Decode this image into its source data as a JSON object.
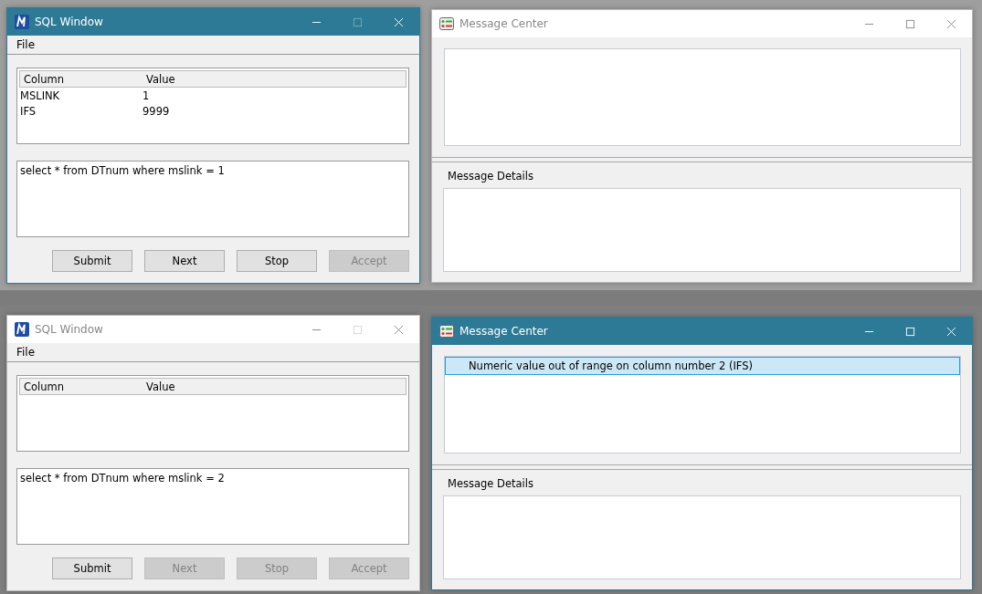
{
  "screens": [
    {
      "sql_window": {
        "title": "SQL Window",
        "active": true,
        "menu": [
          "File"
        ],
        "columns": [
          "Column",
          "Value"
        ],
        "rows": [
          [
            "MSLINK",
            "1"
          ],
          [
            "IFS",
            "9999"
          ]
        ],
        "query": "select * from DTnum where mslink = 1",
        "buttons": [
          {
            "label": "Submit",
            "disabled": false
          },
          {
            "label": "Next",
            "disabled": false
          },
          {
            "label": "Stop",
            "disabled": false
          },
          {
            "label": "Accept",
            "disabled": true
          }
        ]
      },
      "message_center": {
        "title": "Message Center",
        "active": false,
        "details_label": "Message Details"
      }
    },
    {
      "sql_window": {
        "title": "SQL Window",
        "active": false,
        "menu": [
          "File"
        ],
        "columns": [
          "Column",
          "Value"
        ],
        "query": "select * from DTnum where mslink = 2",
        "buttons": [
          {
            "label": "Submit",
            "disabled": false
          },
          {
            "label": "Next",
            "disabled": true
          },
          {
            "label": "Stop",
            "disabled": true
          },
          {
            "label": "Accept",
            "disabled": true
          }
        ]
      },
      "message_center": {
        "title": "Message Center",
        "active": true,
        "messages": [
          {
            "text": "Numeric value out of range on column number 2 (IFS)",
            "selected": true
          }
        ],
        "details_label": "Message Details"
      }
    }
  ]
}
